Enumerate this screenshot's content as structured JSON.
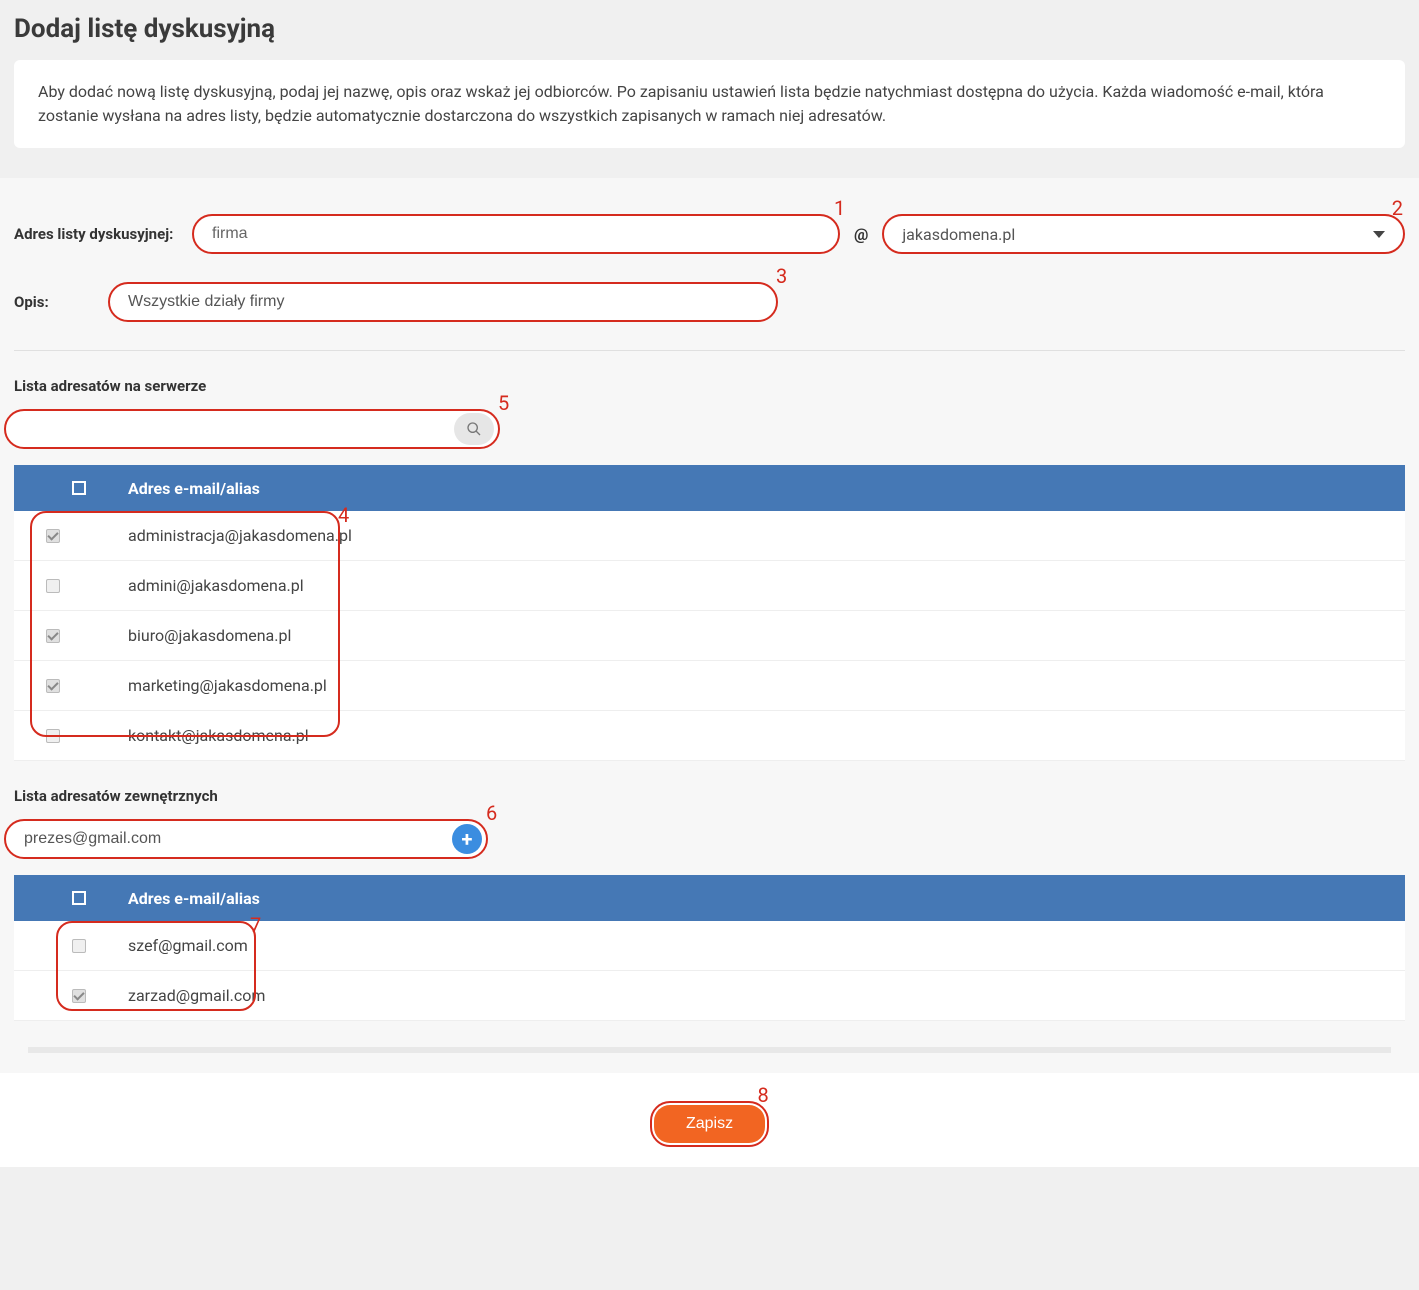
{
  "page": {
    "title": "Dodaj listę dyskusyjną",
    "intro": "Aby dodać nową listę dyskusyjną, podaj jej nazwę, opis oraz wskaż jej odbiorców. Po zapisaniu ustawień lista będzie natychmiast dostępna do użycia. Każda wiadomość e-mail, która zostanie wysłana na adres listy, będzie automatycznie dostarczona do wszystkich zapisanych w ramach niej adresatów."
  },
  "labels": {
    "address": "Adres listy dyskusyjnej:",
    "opis": "Opis:",
    "server_list": "Lista adresatów na serwerze",
    "external_list": "Lista adresatów zewnętrznych",
    "table_header": "Adres e-mail/alias",
    "save": "Zapisz"
  },
  "form": {
    "address_value": "firma",
    "domain_value": "jakasdomena.pl",
    "opis_value": "Wszystkie działy firmy",
    "search_value": "",
    "external_value": "prezes@gmail.com"
  },
  "annotations": {
    "n1": "1",
    "n2": "2",
    "n3": "3",
    "n4": "4",
    "n5": "5",
    "n6": "6",
    "n7": "7",
    "n8": "8"
  },
  "server_recipients": [
    {
      "email": "administracja@jakasdomena.pl",
      "checked": true
    },
    {
      "email": "admini@jakasdomena.pl",
      "checked": false
    },
    {
      "email": "biuro@jakasdomena.pl",
      "checked": true
    },
    {
      "email": "marketing@jakasdomena.pl",
      "checked": true
    },
    {
      "email": "kontakt@jakasdomena.pl",
      "checked": false
    }
  ],
  "external_recipients": [
    {
      "email": "szef@gmail.com",
      "checked": false
    },
    {
      "email": "zarzad@gmail.com",
      "checked": true
    }
  ]
}
